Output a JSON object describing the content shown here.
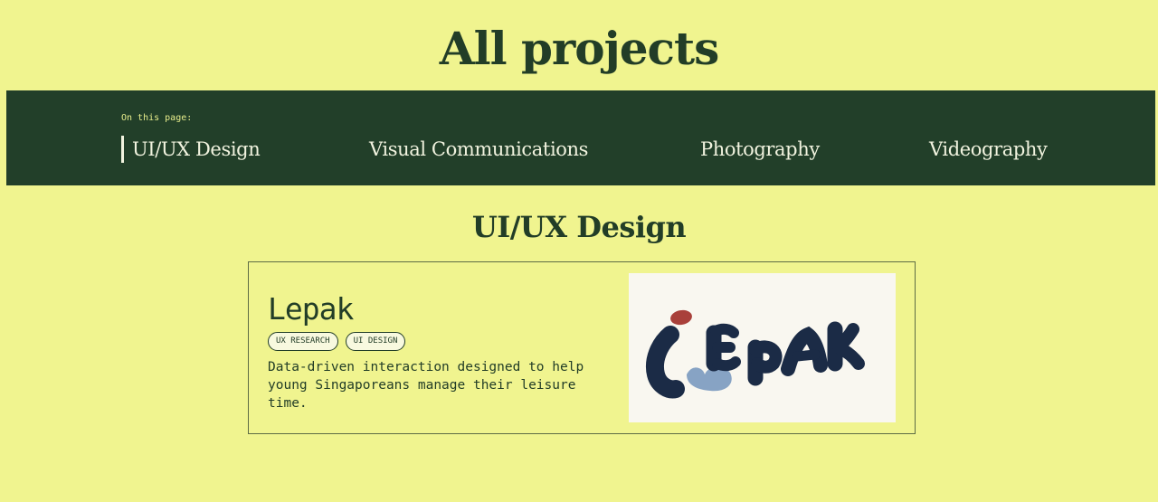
{
  "page": {
    "title": "All projects"
  },
  "nav": {
    "caption": "On this page:",
    "links": [
      {
        "label": "UI/UX Design",
        "active": true
      },
      {
        "label": "Visual Communications",
        "active": false
      },
      {
        "label": "Photography",
        "active": false
      },
      {
        "label": "Videography",
        "active": false
      }
    ]
  },
  "sections": [
    {
      "title": "UI/UX Design",
      "projects": [
        {
          "name": "Lepak",
          "tags": [
            "UX RESEARCH",
            "UI DESIGN"
          ],
          "description": "Data-driven interaction designed to help young Singaporeans manage their leisure time.",
          "thumbnail": {
            "alt": "Lepak logo",
            "logo_text": "LEPAK"
          }
        }
      ]
    }
  ],
  "colors": {
    "background": "#f0f48f",
    "nav_background": "#223f29",
    "text_dark_green": "#223d27",
    "logo_navy": "#1b2b46",
    "logo_red": "#a9403a",
    "logo_light_blue": "#87a3c4"
  }
}
